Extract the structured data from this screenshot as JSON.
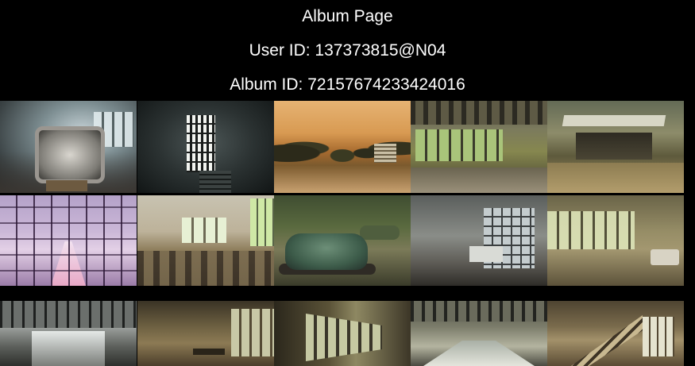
{
  "header": {
    "title": "Album Page",
    "user_id_line": "User ID: 137373815@N04",
    "album_id_line": "Album ID: 72157674233424016"
  },
  "photos": [
    {
      "name": "photo-classroom-tv"
    },
    {
      "name": "photo-dark-doorway"
    },
    {
      "name": "photo-city-square-trees"
    },
    {
      "name": "photo-greenhouse-hall"
    },
    {
      "name": "photo-amusement-stage"
    },
    {
      "name": "photo-pink-steel-frame"
    },
    {
      "name": "photo-hospital-ward-beds"
    },
    {
      "name": "photo-bumper-car"
    },
    {
      "name": "photo-tiled-room-sink"
    },
    {
      "name": "photo-overgrown-room-tub"
    },
    {
      "name": "photo-industrial-hall"
    },
    {
      "name": "photo-dim-room-table"
    },
    {
      "name": "photo-long-corridor"
    },
    {
      "name": "photo-empty-pool-hall"
    },
    {
      "name": "photo-staircase-hall"
    }
  ]
}
